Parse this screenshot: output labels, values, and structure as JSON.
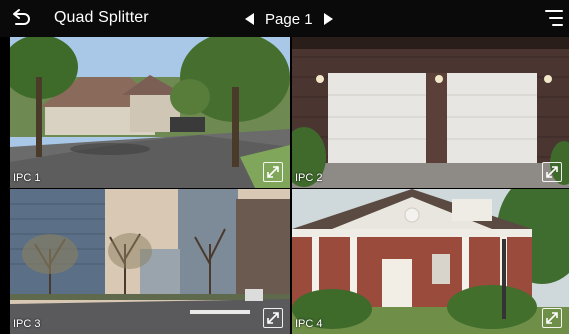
{
  "header": {
    "title": "Quad Splitter",
    "page_label": "Page 1",
    "back_icon": "back-arrow-icon",
    "prev_icon": "triangle-left-icon",
    "next_icon": "triangle-right-icon",
    "menu_icon": "menu-icon"
  },
  "cameras": [
    {
      "label": "IPC 1",
      "expand_icon": "fullscreen-icon"
    },
    {
      "label": "IPC 2",
      "expand_icon": "fullscreen-icon"
    },
    {
      "label": "IPC 3",
      "expand_icon": "fullscreen-icon"
    },
    {
      "label": "IPC 4",
      "expand_icon": "fullscreen-icon"
    }
  ],
  "colors": {
    "topbar_bg": "#0a0a0a",
    "text": "#ffffff"
  }
}
